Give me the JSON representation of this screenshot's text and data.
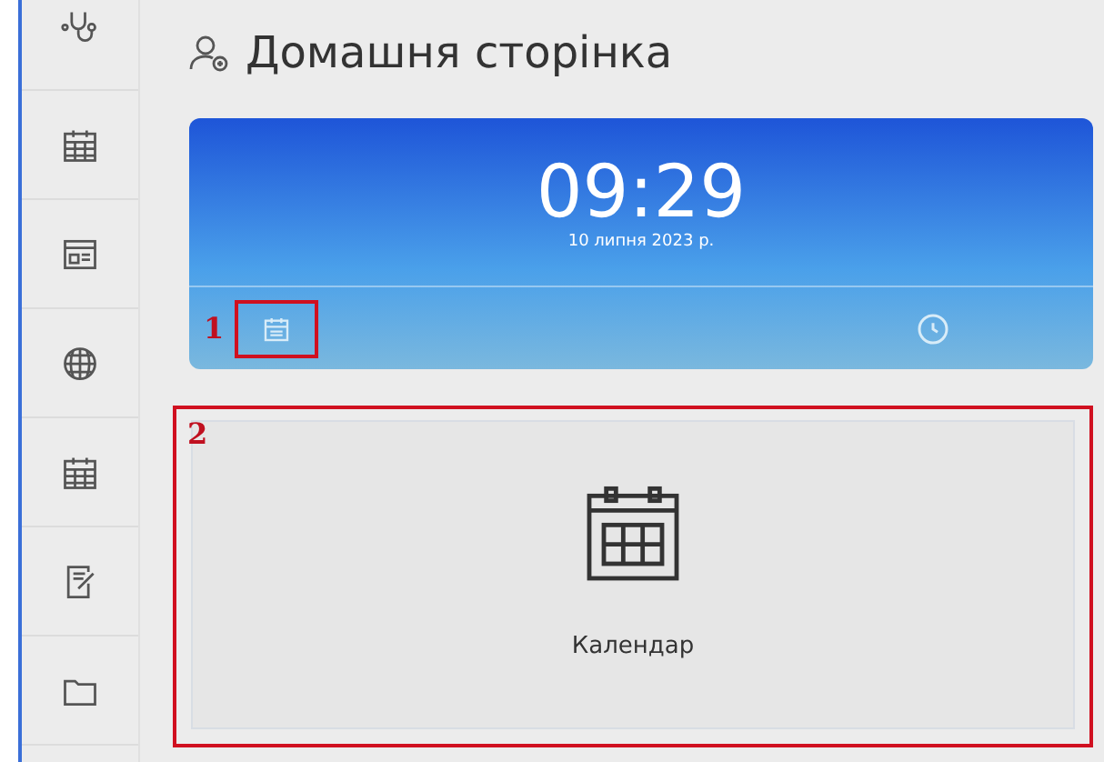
{
  "sidebar": {
    "items": [
      {
        "kind": "stethoscope"
      },
      {
        "kind": "calendar"
      },
      {
        "kind": "idcard"
      },
      {
        "kind": "globe"
      },
      {
        "kind": "calendar"
      },
      {
        "kind": "note"
      },
      {
        "kind": "folder"
      }
    ]
  },
  "header": {
    "title": "Домашня сторінка"
  },
  "clock_card": {
    "time": "09:29",
    "date": "10 липня 2023 р.",
    "marker": "1"
  },
  "tile": {
    "label": "Календар",
    "marker": "2"
  }
}
